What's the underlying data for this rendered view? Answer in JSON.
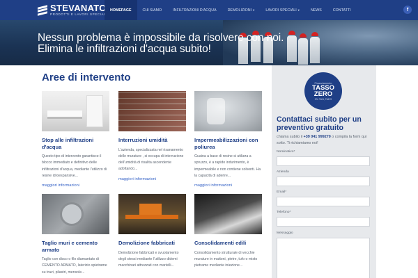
{
  "brand": {
    "name": "STEVANATO",
    "tagline": "PRODOTTI E LAVORI SPECIALI"
  },
  "nav": {
    "items": [
      {
        "label": "HOMEPAGE",
        "active": true
      },
      {
        "label": "CHI SIAMO"
      },
      {
        "label": "INFILTRAZIONI D'ACQUA"
      },
      {
        "label": "DEMOLIZIONI",
        "has_dropdown": true
      },
      {
        "label": "LAVORI SPECIALI",
        "has_dropdown": true
      },
      {
        "label": "NEWS"
      },
      {
        "label": "CONTATTI"
      }
    ],
    "facebook_icon": "facebook-icon",
    "facebook_label": "f"
  },
  "hero": {
    "line1": "Nessun problema è impossibile da risolvere con noi.",
    "line2": "Elimina le infiltrazioni d'acqua subito!"
  },
  "main": {
    "title": "Aree di intervento",
    "cards": [
      {
        "title": "Stop alle infiltrazioni d'acqua",
        "desc": "Questo tipo di intervento garantisce il blocco immediato e definitivo delle infiltrazioni d'acqua, mediante l'utilizzo di resine idroespansive...",
        "more": "maggiori informazioni"
      },
      {
        "title": "Interruzioni umidità",
        "desc": "L'azienda, specializzata nel risanamento delle murature , si occupa di interruzione dell'umidità di risalita ascendente adottando...",
        "more": "maggiori informazioni"
      },
      {
        "title": "Impermeabilizzazioni con poliurea",
        "desc": "Guaina a base di resine si utilizza a spruzzo, è a rapido indurimento, è impermeabile e non contiene solventi. Ha la capacità di aderire...",
        "more": "maggiori informazioni"
      },
      {
        "title": "Taglio muri e cemento armato",
        "desc": "Taglio con disco o filo diamantato di CEMENTO ARMATO, laterizio spietrame su travi, pilastri, mensole..."
      },
      {
        "title": "Demolizione fabbricati",
        "desc": "Demolizione fabbricati e svuotamento degli stessi mediante l'utilizzo didemi macchinari attrezzati con martelli..."
      },
      {
        "title": "Consolidamenti edili",
        "desc": "Consolidamento strutturale di vecchie murature in mattoni, pietre, tufo o misto pietrame mediante iniezione..."
      }
    ]
  },
  "sidebar": {
    "badge": {
      "line1": "Finanziamento",
      "line2": "TASSO",
      "line3": "ZERO",
      "line4": "0% TAN, TAEG"
    },
    "contact_title": "Contattaci subito per un preventivo gratuito",
    "contact_text_pre": "chiama subito il ",
    "phone": "+39 041 999270",
    "contact_text_post": " o compila la form qui sotto. Ti richiamiamo noi!",
    "fields": [
      {
        "label": "Nominativo*"
      },
      {
        "label": "Azienda"
      },
      {
        "label": "Email*"
      },
      {
        "label": "Telefono*"
      },
      {
        "label": "Messaggio"
      }
    ]
  },
  "colors": {
    "primary": "#1f3f86",
    "link": "#3a66c8",
    "sidebar_bg": "#e7e9ec",
    "helmet": "#d32222"
  }
}
